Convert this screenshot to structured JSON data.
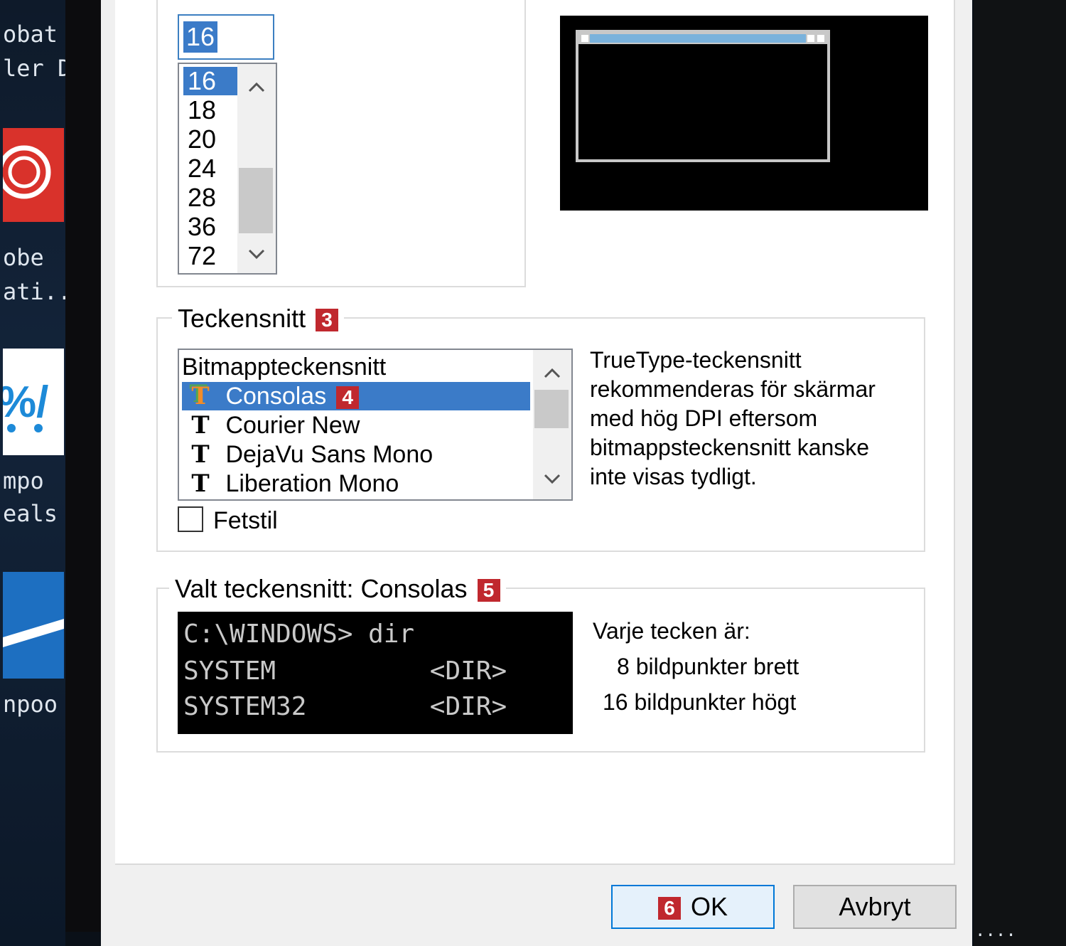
{
  "desktop": {
    "labels": [
      "obat",
      "ler DC",
      "obe",
      "ati...",
      "mpo",
      "eals",
      "npoo"
    ],
    "right_label": "...."
  },
  "size": {
    "input_value": "16",
    "options": [
      "16",
      "18",
      "20",
      "24",
      "28",
      "36",
      "72"
    ],
    "selected": "16"
  },
  "font": {
    "legend": "Teckensnitt",
    "legend_badge": "3",
    "options": [
      {
        "label": "Bitmappteckensnitt",
        "icon": "none"
      },
      {
        "label": "Consolas",
        "icon": "truetype-font-icon",
        "badge": "4",
        "selected": true
      },
      {
        "label": "Courier New",
        "icon": "truetype-font-icon"
      },
      {
        "label": "DejaVu Sans Mono",
        "icon": "truetype-font-icon"
      },
      {
        "label": "Liberation Mono",
        "icon": "truetype-font-icon"
      }
    ],
    "bold_label": "Fetstil",
    "bold_checked": false,
    "info": "TrueType-teckensnitt rekommenderas för skärmar med hög DPI eftersom bitmappsteckensnitt kanske inte visas tydligt."
  },
  "selected_font": {
    "legend": "Valt teckensnitt: Consolas",
    "legend_badge": "5",
    "console_lines": [
      "C:\\WINDOWS> dir",
      "SYSTEM          <DIR>",
      "SYSTEM32        <DIR>"
    ],
    "char_heading": "Varje tecken är:",
    "width_line": "8 bildpunkter brett",
    "height_line": "16 bildpunkter högt"
  },
  "buttons": {
    "ok_badge": "6",
    "ok_label": "OK",
    "cancel_label": "Avbryt"
  },
  "colors": {
    "selection": "#3b7bc8",
    "badge": "#c0282e",
    "focus_border": "#0078d7"
  }
}
